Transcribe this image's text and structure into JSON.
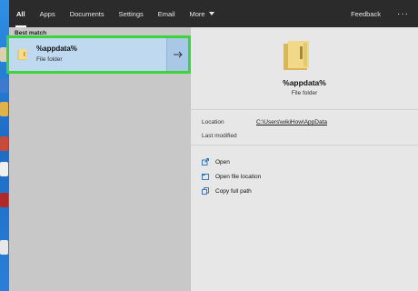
{
  "tabs": [
    {
      "label": "All",
      "active": true
    },
    {
      "label": "Apps"
    },
    {
      "label": "Documents"
    },
    {
      "label": "Settings"
    },
    {
      "label": "Email"
    },
    {
      "label": "More"
    }
  ],
  "topbar": {
    "feedback": "Feedback",
    "more_options": "···"
  },
  "left": {
    "section_label": "Best match",
    "result": {
      "title": "%appdata%",
      "subtitle": "File folder",
      "icon": "folder-icon",
      "arrow_icon": "arrow-right-icon"
    }
  },
  "preview": {
    "title": "%appdata%",
    "subtitle": "File folder",
    "location_label": "Location",
    "location_value": "C:\\Users\\wikiHow\\AppData",
    "modified_label": "Last modified",
    "actions": [
      {
        "label": "Open",
        "icon": "open-icon"
      },
      {
        "label": "Open file location",
        "icon": "file-location-icon"
      },
      {
        "label": "Copy full path",
        "icon": "copy-icon"
      }
    ]
  },
  "colors": {
    "highlight_border": "#3bd43b",
    "selection": "#bfd9f0",
    "topbar": "#2b2b2b"
  }
}
